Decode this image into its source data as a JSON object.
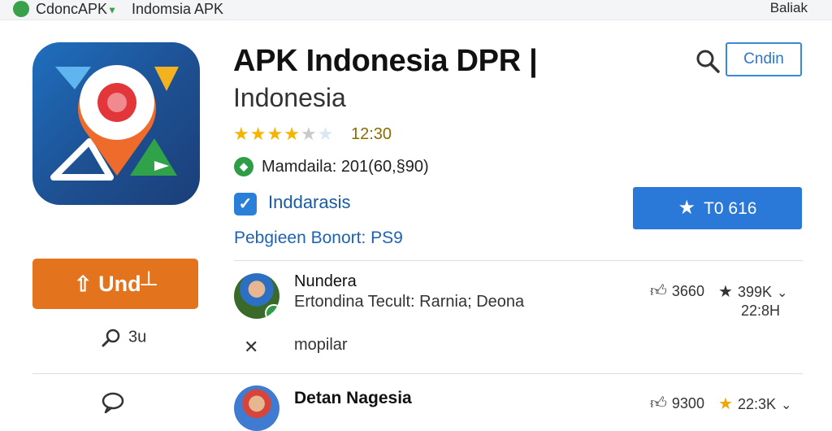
{
  "topbar": {
    "brand": "CdoncAPK",
    "brand_accent": "▼",
    "site_name": "Indomsia APK",
    "right_label": "Baliak"
  },
  "app": {
    "title": "APK Indonesia DPR |",
    "subtitle": "Indonesia",
    "rating_stars": 4,
    "rating_value": "12:30",
    "developer": "Mamdaila: 201(60,§90)",
    "checkbox_label": "Inddarasis",
    "link_text": "Pebgieen Bonort: PS9"
  },
  "actions": {
    "outline_button": "Cndin",
    "primary_button": "T0 616",
    "orange_button": "Und┴",
    "side_search_count": "3u"
  },
  "reviews": [
    {
      "name": "Nundera",
      "text": "Ertondina Tecult: Rarnia; Deona",
      "likes": "3660",
      "stars_count": "399K",
      "time": "22:8H",
      "note": "mopilar"
    },
    {
      "name": "Detan Nagesia",
      "likes": "9300",
      "stars_count": "22:3K"
    }
  ],
  "icons": {
    "brand": "brand-logo-icon",
    "search": "search-icon",
    "check": "checkbox-icon",
    "star": "star-icon",
    "upload": "upload-icon",
    "like": "thumbs-up-icon",
    "chevron": "chevron-down-icon",
    "comment": "comment-icon",
    "tool": "tool-icon"
  },
  "colors": {
    "accent_blue": "#2a78d8",
    "accent_orange": "#e3731d",
    "accent_green": "#2e9d46",
    "star_yellow": "#f4b400"
  }
}
